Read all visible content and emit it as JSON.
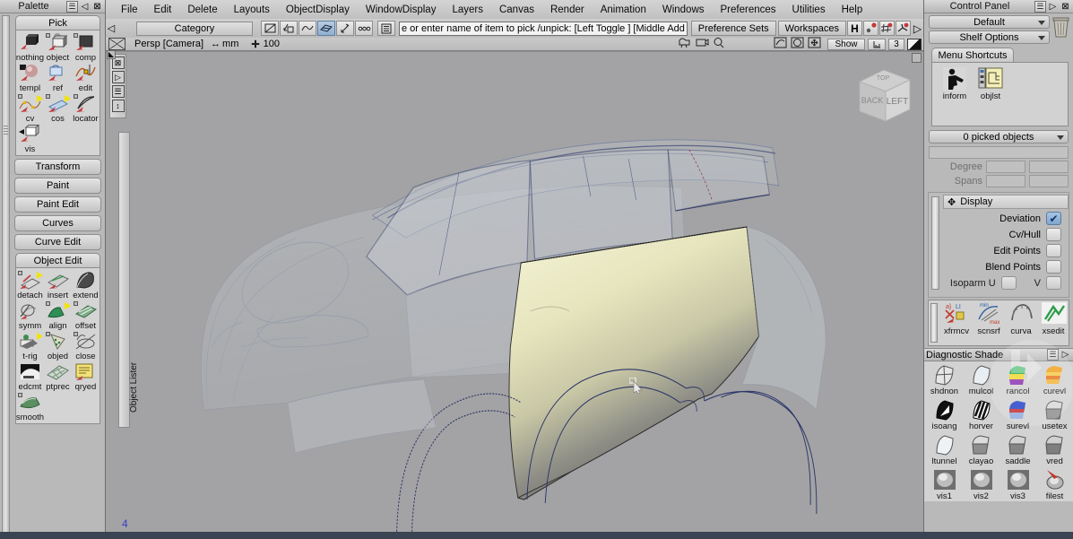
{
  "app": {
    "menubar": [
      "File",
      "Edit",
      "Delete",
      "Layouts",
      "ObjectDisplay",
      "WindowDisplay",
      "Layers",
      "Canvas",
      "Render",
      "Animation",
      "Windows",
      "Preferences",
      "Utilities",
      "Help"
    ]
  },
  "palette": {
    "title": "Palette",
    "groups": [
      {
        "name": "Pick",
        "type": "tab",
        "items": [
          {
            "label": "nothing",
            "icon": "pick-nothing-icon"
          },
          {
            "label": "object",
            "icon": "pick-object-icon"
          },
          {
            "label": "comp",
            "icon": "pick-component-icon"
          },
          {
            "label": "templ",
            "icon": "pick-template-icon"
          },
          {
            "label": "ref",
            "icon": "pick-reference-icon"
          },
          {
            "label": "edit",
            "icon": "pick-edit-icon"
          },
          {
            "label": "cv",
            "icon": "pick-cv-icon"
          },
          {
            "label": "cos",
            "icon": "pick-cos-icon"
          },
          {
            "label": "locator",
            "icon": "pick-locator-icon"
          },
          {
            "label": "vis",
            "icon": "pick-visible-icon"
          }
        ]
      },
      {
        "name": "Transform",
        "type": "section",
        "items": []
      },
      {
        "name": "Paint",
        "type": "section",
        "items": []
      },
      {
        "name": "Paint Edit",
        "type": "section",
        "items": []
      },
      {
        "name": "Curves",
        "type": "section",
        "items": []
      },
      {
        "name": "Curve Edit",
        "type": "section",
        "items": []
      },
      {
        "name": "Object Edit",
        "type": "tab",
        "items": [
          {
            "label": "detach",
            "icon": "detach-icon"
          },
          {
            "label": "insert",
            "icon": "insert-icon"
          },
          {
            "label": "extend",
            "icon": "extend-icon"
          },
          {
            "label": "symm",
            "icon": "symmetry-icon"
          },
          {
            "label": "align",
            "icon": "align-icon"
          },
          {
            "label": "offset",
            "icon": "offset-icon"
          },
          {
            "label": "t-rig",
            "icon": "trim-rig-icon"
          },
          {
            "label": "objed",
            "icon": "object-edit-icon"
          },
          {
            "label": "close",
            "icon": "close-surface-icon"
          },
          {
            "label": "edcmt",
            "icon": "edit-comment-icon"
          },
          {
            "label": "ptprec",
            "icon": "point-precision-icon"
          },
          {
            "label": "qryed",
            "icon": "query-edit-icon"
          },
          {
            "label": "smooth",
            "icon": "smooth-icon"
          }
        ]
      }
    ]
  },
  "toolbar": {
    "category_label": "Category",
    "icons": [
      {
        "name": "no-snap-icon",
        "glyph": "⊘",
        "selected": false
      },
      {
        "name": "grid-snap-icon",
        "glyph": "⌂",
        "selected": false
      },
      {
        "name": "curve-snap-icon",
        "glyph": "∿",
        "selected": false
      },
      {
        "name": "surface-snap-icon",
        "glyph": "▨",
        "selected": true
      },
      {
        "name": "point-snap-icon",
        "glyph": "✛",
        "selected": false
      },
      {
        "name": "construction-history-icon",
        "glyph": "∘∘∘",
        "selected": false
      },
      {
        "name": "list-icon",
        "glyph": "☰",
        "selected": false
      }
    ],
    "prompt_value": "e or enter name of item to pick /unpick: [Left Toggle ] [Middle Add ] [Right Unpick ]",
    "preference_sets_label": "Preference Sets",
    "workspaces_label": "Workspaces",
    "right_icons": [
      {
        "name": "layout-h-icon",
        "glyph": "H"
      },
      {
        "name": "construction-plane-icon",
        "glyph": "⊙"
      },
      {
        "name": "grid-toggle-icon",
        "glyph": "#"
      },
      {
        "name": "light-toggle-icon",
        "glyph": "✳"
      },
      {
        "name": "expand-arrow-icon",
        "glyph": "▷"
      }
    ]
  },
  "viewrow": {
    "camera_label": "Persp [Camera]",
    "units_glyph": "↔",
    "units": "mm",
    "zoom_glyph": "✛",
    "zoom_value": "100",
    "icons": [
      {
        "name": "camera-icon",
        "glyph": "🎥"
      },
      {
        "name": "camera-lock-icon",
        "glyph": "▣"
      },
      {
        "name": "zoom-magnifier-icon",
        "glyph": "🔍"
      },
      {
        "name": "orbit-icon",
        "glyph": "↺"
      },
      {
        "name": "fit-view-icon",
        "glyph": "◯"
      },
      {
        "name": "pan-icon",
        "glyph": "✥"
      }
    ],
    "show_label": "Show",
    "ruler_icon": "ruler-icon",
    "layer_value": "3",
    "color_swatch_name": "color-swatch"
  },
  "viewport": {
    "side_tools": [
      {
        "name": "viewport-close-icon",
        "glyph": "⊠"
      },
      {
        "name": "viewport-expand-icon",
        "glyph": "▷"
      },
      {
        "name": "viewport-list-icon",
        "glyph": "☰"
      },
      {
        "name": "viewport-resize-icon",
        "glyph": "↕"
      }
    ],
    "object_lister_label": "Object Lister",
    "view_cube": {
      "front_face": "BACK",
      "right_face": "LEFT",
      "top_face": "TOP"
    },
    "axis_label": "4",
    "background_color": "#a3a3a5",
    "model_description": "Automotive class-A surfacing model — car body shell in wireframe with one shaded door panel",
    "shaded_panel_colors": [
      "#e9e8c6",
      "#d6d5a9",
      "#6e6e70"
    ]
  },
  "control_panel": {
    "title": "Control Panel",
    "preset_dropdown": "Default",
    "shelf_options_dropdown": "Shelf Options",
    "trash_icon": "trash-icon",
    "shelf_tab": "Menu Shortcuts",
    "shelf_items": [
      {
        "label": "inform",
        "icon": "information-icon"
      },
      {
        "label": "objlst",
        "icon": "object-list-icon"
      }
    ],
    "picked_objects": "0 picked objects",
    "fields": [
      {
        "label": "Degree",
        "value": "",
        "value2": ""
      },
      {
        "label": "Spans",
        "value": "",
        "value2": ""
      }
    ],
    "display_section": {
      "title": "Display",
      "move_icon": "move-handle-icon",
      "rows": [
        {
          "label": "Deviation",
          "checked": true
        },
        {
          "label": "Cv/Hull",
          "checked": false
        },
        {
          "label": "Edit Points",
          "checked": false
        },
        {
          "label": "Blend Points",
          "checked": false
        },
        {
          "label": "Isoparm U",
          "checked": false
        }
      ]
    },
    "tool_shelf": [
      {
        "label": "xfrmcv",
        "icon": "transform-cv-icon"
      },
      {
        "label": "scnsrf",
        "icon": "scan-surface-icon"
      },
      {
        "label": "curva",
        "icon": "curvature-icon"
      },
      {
        "label": "xsedit",
        "icon": "cross-section-edit-icon"
      }
    ],
    "diagnostic": {
      "title": "Diagnostic Shade",
      "menu_icon": "hamburger-icon",
      "expand_icon": "expand-arrow-icon",
      "items": [
        {
          "label": "shdnon",
          "icon": "shade-none-icon"
        },
        {
          "label": "mulcol",
          "icon": "multi-color-icon"
        },
        {
          "label": "rancol",
          "icon": "random-color-icon"
        },
        {
          "label": "curevl",
          "icon": "curvature-evaluate-icon"
        },
        {
          "label": "isoang",
          "icon": "iso-angle-icon"
        },
        {
          "label": "horver",
          "icon": "horizontal-vertical-icon"
        },
        {
          "label": "surevl",
          "icon": "surface-evaluate-icon"
        },
        {
          "label": "usetex",
          "icon": "use-texture-icon"
        },
        {
          "label": "ltunnel",
          "icon": "light-tunnel-icon"
        },
        {
          "label": "clayao",
          "icon": "clay-ao-icon"
        },
        {
          "label": "saddle",
          "icon": "saddle-icon"
        },
        {
          "label": "vred",
          "icon": "vred-icon"
        },
        {
          "label": "vis1",
          "icon": "visual-1-icon"
        },
        {
          "label": "vis2",
          "icon": "visual-2-icon"
        },
        {
          "label": "vis3",
          "icon": "visual-3-icon"
        },
        {
          "label": "filest",
          "icon": "file-settings-icon"
        }
      ]
    }
  }
}
